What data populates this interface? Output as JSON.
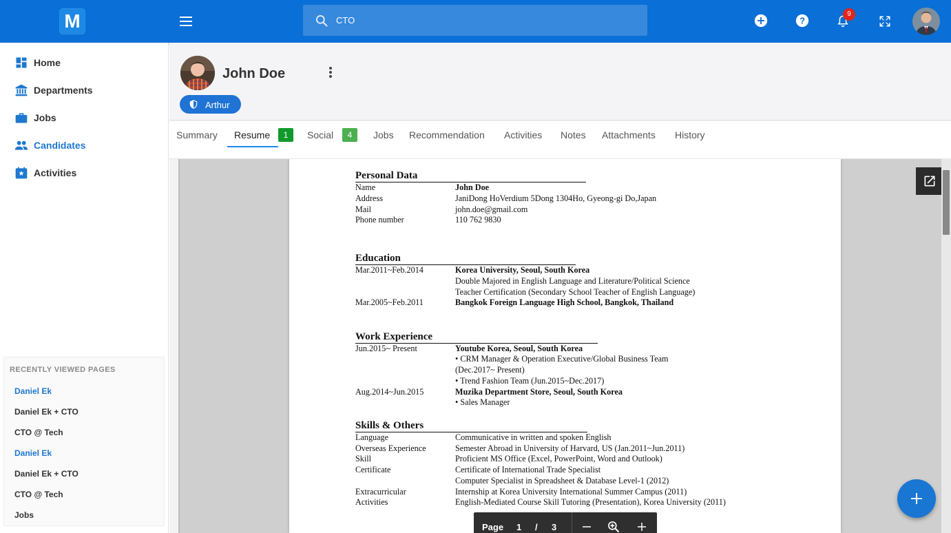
{
  "app": {
    "logo_letter": "M",
    "accent_color": "#0a6fd6"
  },
  "search": {
    "value": "CTO",
    "icon": "search-icon"
  },
  "topbar": {
    "notification_count": "9",
    "icons": [
      "add-circle-icon",
      "help-icon",
      "bell-icon",
      "fullscreen-icon"
    ]
  },
  "sidebar": {
    "items": [
      {
        "label": "Home",
        "icon": "dashboard-icon"
      },
      {
        "label": "Departments",
        "icon": "bank-icon"
      },
      {
        "label": "Jobs",
        "icon": "briefcase-icon"
      },
      {
        "label": "Candidates",
        "icon": "people-icon"
      },
      {
        "label": "Activities",
        "icon": "star-calendar-icon"
      }
    ],
    "recent_title": "RECENTLY VIEWED PAGES",
    "recent": [
      "Daniel Ek",
      "Daniel Ek + CTO",
      "CTO @ Tech",
      "Daniel Ek",
      "Daniel Ek + CTO",
      "CTO @ Tech",
      "Jobs"
    ]
  },
  "profile": {
    "name": "John Doe",
    "owner_chip": "Arthur"
  },
  "tabs": [
    {
      "label": "Summary"
    },
    {
      "label": "Resume",
      "count": "1"
    },
    {
      "label": "Social",
      "count": "4"
    },
    {
      "label": "Jobs"
    },
    {
      "label": "Recommendation"
    },
    {
      "label": "Activities"
    },
    {
      "label": "Notes"
    },
    {
      "label": "Attachments"
    },
    {
      "label": "History"
    }
  ],
  "resume": {
    "personal_title": "Personal Data",
    "personal": [
      [
        "Name",
        "John Doe"
      ],
      [
        "Address",
        "JaniDong HoVerdium 5Dong 1304Ho, Gyeong-gi Do,Japan"
      ],
      [
        "Mail",
        "john.doe@gmail.com"
      ],
      [
        "Phone number",
        "110 762 9830"
      ]
    ],
    "education_title": "Education",
    "education": [
      [
        "Mar.2011~Feb.2014",
        "Korea University, Seoul, South Korea"
      ],
      [
        "",
        "Double Majored in English Language and Literature/Political Science"
      ],
      [
        "",
        "Teacher Certification (Secondary School Teacher of English Language)"
      ],
      [
        "Mar.2005~Feb.2011",
        "Bangkok Foreign Language High School, Bangkok, Thailand"
      ]
    ],
    "work_title": "Work Experience",
    "work": [
      [
        "Jun.2015~ Present",
        "Youtube Korea, Seoul, South Korea"
      ],
      [
        "",
        "• CRM Manager & Operation Executive/Global Business Team"
      ],
      [
        "",
        "(Dec.2017~ Present)"
      ],
      [
        "",
        "• Trend Fashion Team (Jun.2015~Dec.2017)"
      ],
      [
        "Aug.2014~Jun.2015",
        "Muzika Department Store, Seoul, South Korea"
      ],
      [
        "",
        "• Sales Manager"
      ]
    ],
    "skills_title": "Skills & Others",
    "skills": [
      [
        "Language",
        "Communicative in written and spoken English"
      ],
      [
        "Overseas Experience",
        "Semester Abroad in University of Harvard, US (Jan.2011~Jun.2011)"
      ],
      [
        "Skill",
        "Proficient MS Office (Excel, PowerPoint, Word and Outlook)"
      ],
      [
        "Certificate",
        "Certificate of International Trade Specialist"
      ],
      [
        "",
        "Computer Specialist in Spreadsheet & Database Level-1 (2012)"
      ],
      [
        "Extracurricular",
        "Internship at Korea University International Summer Campus (2011)"
      ],
      [
        "Activities",
        "English-Mediated Course Skill Tutoring (Presentation), Korea University (2011)"
      ]
    ]
  },
  "pager": {
    "label": "Page",
    "current": "1",
    "separator": "/",
    "total": "3"
  }
}
